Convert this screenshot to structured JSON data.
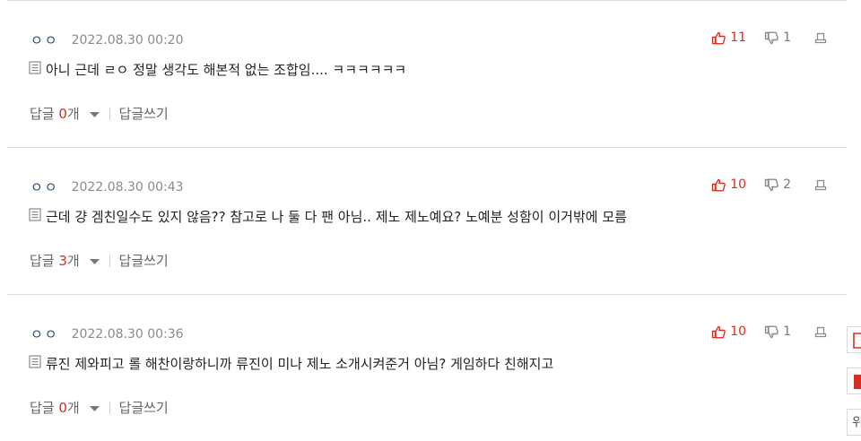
{
  "comments": [
    {
      "author": "ㅇㅇ",
      "date": "2022.08.30 00:20",
      "likes": "11",
      "dislikes": "1",
      "text": "아니 근데 ㄹㅇ 정말 생각도 해본적 없는 조합임.... ㅋㅋㅋㅋㅋㅋ",
      "reply_label": "답글 ",
      "reply_count": "0",
      "reply_unit": "개",
      "write_reply": "답글쓰기"
    },
    {
      "author": "ㅇㅇ",
      "date": "2022.08.30 00:43",
      "likes": "10",
      "dislikes": "2",
      "text": "근데 걍 겜친일수도 있지 않음?? 참고로 나 둘 다 팬 아님.. 제노 제노예요? 노예분 성함이 이거밖에 모름",
      "reply_label": "답글 ",
      "reply_count": "3",
      "reply_unit": "개",
      "write_reply": "답글쓰기"
    },
    {
      "author": "ㅇㅇ",
      "date": "2022.08.30 00:36",
      "likes": "10",
      "dislikes": "1",
      "text": "류진 제와피고 롤 해찬이랑하니까 류진이 미나 제노 소개시켜준거 아님? 게임하다 친해지고",
      "reply_label": "답글 ",
      "reply_count": "0",
      "reply_unit": "개",
      "write_reply": "답글쓰기"
    }
  ],
  "side_tabs": [
    "",
    "",
    "위"
  ],
  "colors": {
    "accent": "#d62d20",
    "author": "#2b4f7a",
    "muted": "#8a8a8a",
    "divider": "#dddddd"
  },
  "icons": {
    "like": "thumbs-up-icon",
    "dislike": "thumbs-down-icon",
    "report": "report-icon",
    "document": "document-icon",
    "caret": "caret-down-icon"
  }
}
